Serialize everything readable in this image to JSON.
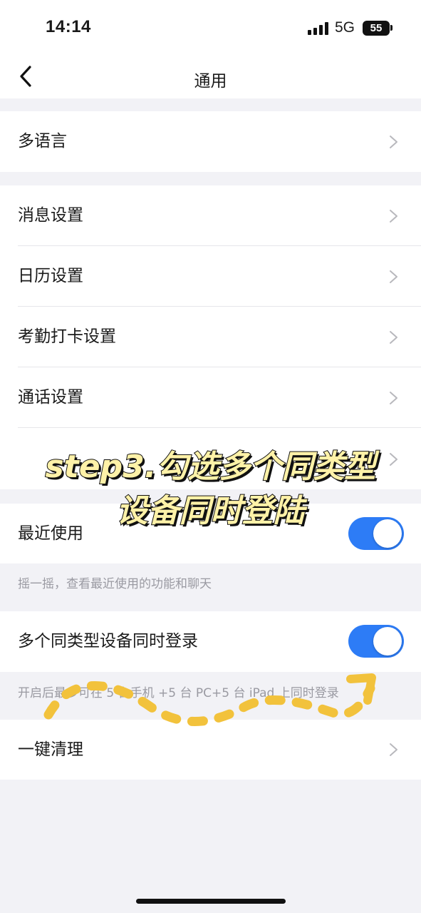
{
  "status_bar": {
    "time": "14:14",
    "network": "5G",
    "battery": "55"
  },
  "nav": {
    "title": "通用"
  },
  "groups": {
    "language": {
      "label": "多语言"
    },
    "settings": {
      "items": [
        {
          "label": "消息设置"
        },
        {
          "label": "日历设置"
        },
        {
          "label": "考勤打卡设置"
        },
        {
          "label": "通话设置"
        }
      ]
    },
    "recent": {
      "label": "最近使用",
      "enabled": true,
      "hint": "摇一摇，查看最近使用的功能和聊天"
    },
    "multi_login": {
      "label": "多个同类型设备同时登录",
      "enabled": true,
      "hint": "开启后最多可在 5 台手机 +5 台 PC+5 台 iPad 上同时登录"
    },
    "clean": {
      "label": "一键清理"
    }
  },
  "overlay": {
    "line1": "step3.勾选多个同类型",
    "line2": "设备同时登陆",
    "text_color": "#fff2a8",
    "arrow_color": "#f2c23c"
  },
  "colors": {
    "accent": "#2d7cf6",
    "background": "#f2f2f6"
  }
}
